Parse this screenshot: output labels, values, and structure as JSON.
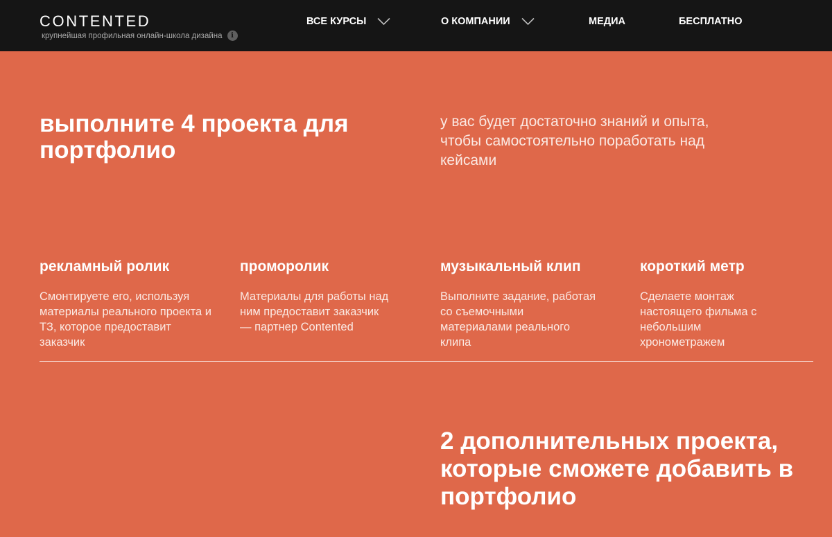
{
  "header": {
    "logo": "CONTENTED",
    "tagline": "крупнейшая профильная онлайн-школа дизайна",
    "info_icon": "i",
    "nav": [
      {
        "label": "ВСЕ КУРСЫ",
        "has_dropdown": true
      },
      {
        "label": "О КОМПАНИИ",
        "has_dropdown": true
      },
      {
        "label": "МЕДИА",
        "has_dropdown": false
      },
      {
        "label": "БЕСПЛАТНО",
        "has_dropdown": false
      }
    ]
  },
  "hero": {
    "title": "выполните 4 проекта для портфолио",
    "description": "у вас будет достаточно знаний и опыта, чтобы самостоятельно поработать над кейсами"
  },
  "projects": [
    {
      "title": "рекламный ролик",
      "text": "Смонтируете его, используя материалы реального проекта и ТЗ, которое предоставит заказчик"
    },
    {
      "title": "проморолик",
      "text": "Материалы для работы над ним предоставит заказчик — партнер Contented"
    },
    {
      "title": "музыкальный клип",
      "text": "Выполните задание, работая со съемочными материалами реального клипа"
    },
    {
      "title": "короткий метр",
      "text": "Сделаете монтаж настоящего фильма с небольшим хронометражем"
    }
  ],
  "extra": {
    "title": "2 дополнительных проекта, которые сможете добавить в портфолио"
  },
  "colors": {
    "header_bg": "#151515",
    "page_bg": "#DF684A",
    "text": "#ffffff"
  },
  "icons": {
    "dropdown": "chevron-down-icon",
    "info": "info-icon"
  }
}
